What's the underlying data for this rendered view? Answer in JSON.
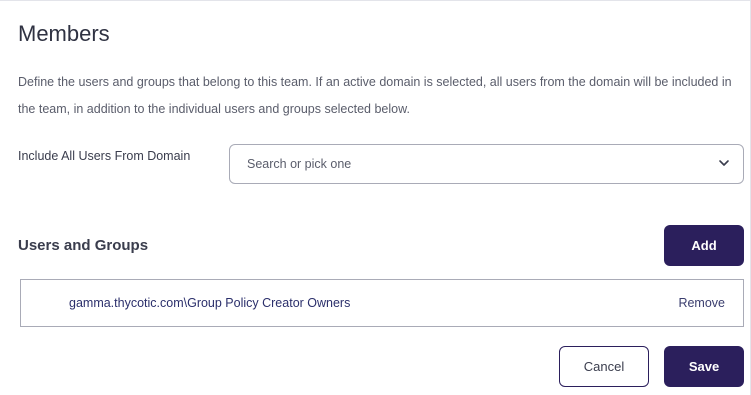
{
  "members": {
    "title": "Members",
    "description": "Define the users and groups that belong to this team. If an active domain is selected, all users from the domain will be included in the team, in addition to the individual users and groups selected below.",
    "domain_field": {
      "label": "Include All Users From Domain",
      "placeholder": "Search or pick one"
    },
    "users_groups": {
      "title": "Users and Groups",
      "add_label": "Add",
      "items": [
        {
          "name": "gamma.thycotic.com\\Group Policy Creator Owners",
          "action": "Remove"
        }
      ]
    },
    "footer": {
      "cancel_label": "Cancel",
      "save_label": "Save"
    }
  },
  "colors": {
    "primary": "#2b1f5c",
    "border": "#a9abb7",
    "text": "#3a3d4d",
    "link": "#2b2f6b"
  },
  "icons": {
    "dropdown": "chevron-down-icon"
  }
}
